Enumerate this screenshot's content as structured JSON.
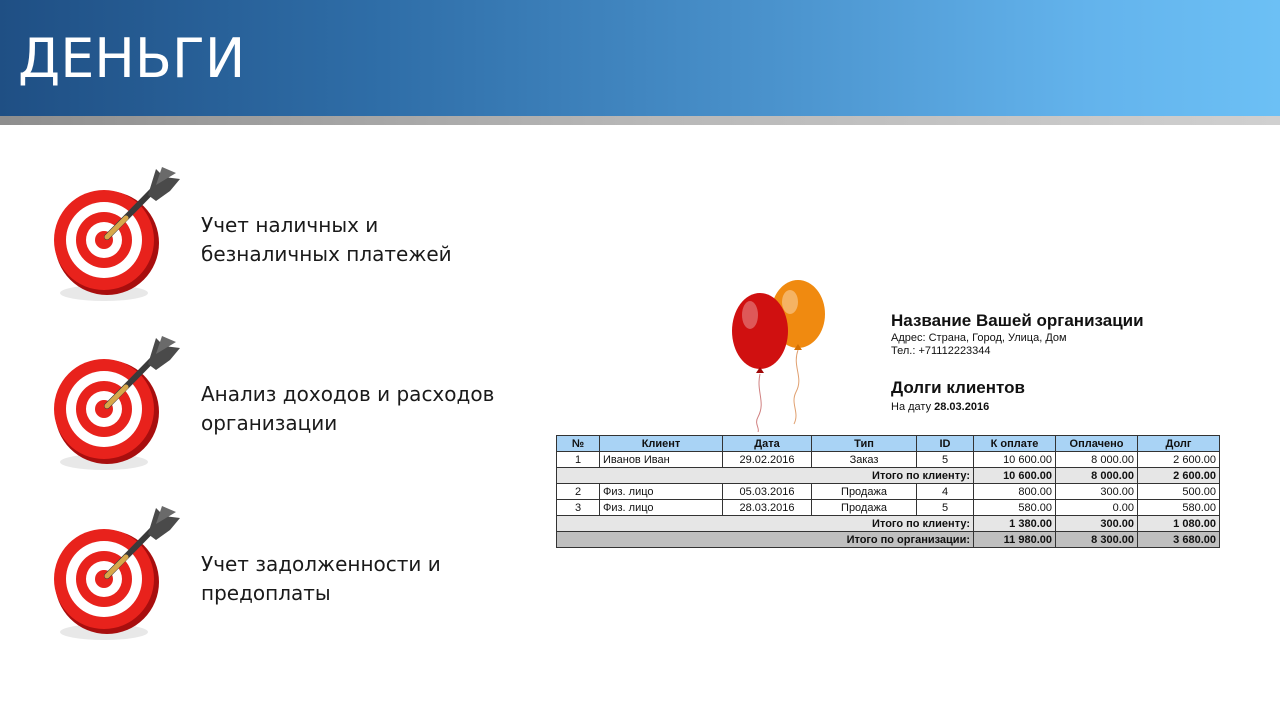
{
  "slide": {
    "title": "ДЕНЬГИ"
  },
  "bullets": [
    {
      "text": "Учет наличных и\nбезналичных платежей",
      "icon": "dart-target-icon"
    },
    {
      "text": "Анализ доходов и расходов\nорганизации",
      "icon": "dart-target-icon"
    },
    {
      "text": "Учет задолженности и\nпредоплаты",
      "icon": "dart-target-icon"
    }
  ],
  "report": {
    "org_name": "Название Вашей организации",
    "address": "Адрес: Страна, Город, Улица, Дом",
    "phone": "Тел.: +71112223344",
    "title": "Долги клиентов",
    "date_prefix": "На дату",
    "date": "28.03.2016",
    "columns": [
      "№",
      "Клиент",
      "Дата",
      "Тип",
      "ID",
      "К оплате",
      "Оплачено",
      "Долг"
    ],
    "rows": [
      [
        "1",
        "Иванов Иван",
        "29.02.2016",
        "Заказ",
        "5",
        "10 600.00",
        "8 000.00",
        "2 600.00"
      ],
      [
        "2",
        "Физ. лицо",
        "05.03.2016",
        "Продажа",
        "4",
        "800.00",
        "300.00",
        "500.00"
      ],
      [
        "3",
        "Физ. лицо",
        "28.03.2016",
        "Продажа",
        "5",
        "580.00",
        "0.00",
        "580.00"
      ]
    ],
    "subtotal_label": "Итого по клиенту:",
    "subtotals": [
      [
        "10 600.00",
        "8 000.00",
        "2 600.00"
      ],
      [
        "1 380.00",
        "300.00",
        "1 080.00"
      ]
    ],
    "total_label": "Итого по организации:",
    "total": [
      "11 980.00",
      "8 300.00",
      "3 680.00"
    ]
  },
  "colors": {
    "header_dark": "#1f4f84",
    "header_light": "#6cc0f5",
    "table_header": "#a9d3f5",
    "subtotal_bg": "#e6e6e6",
    "total_bg": "#bfbfbf",
    "balloon_red": "#d01010",
    "balloon_orange": "#f08a10"
  }
}
